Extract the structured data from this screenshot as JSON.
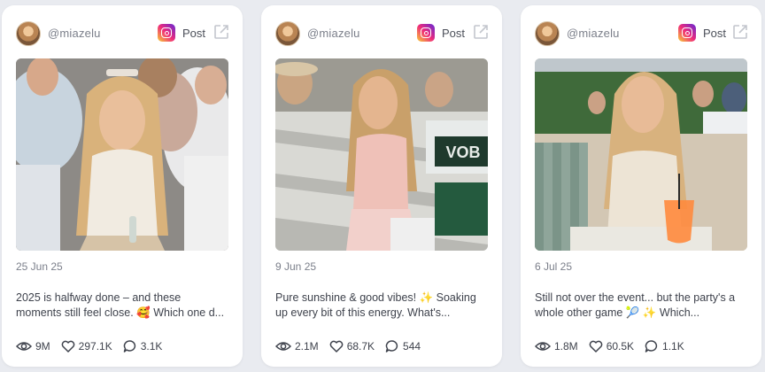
{
  "cards": [
    {
      "handle": "@miazelu",
      "platform_icon": "instagram-icon",
      "post_label": "Post",
      "date": "25 Jun 25",
      "caption": "2025 is halfway done – and these moments still feel close. 🥰 Which one d...",
      "views": "9M",
      "likes": "297.1K",
      "comments": "3.1K"
    },
    {
      "handle": "@miazelu",
      "platform_icon": "instagram-icon",
      "post_label": "Post",
      "date": "9 Jun 25",
      "caption": "Pure sunshine & good vibes! ✨ Soaking up every bit of this energy. What's...",
      "views": "2.1M",
      "likes": "68.7K",
      "comments": "544"
    },
    {
      "handle": "@miazelu",
      "platform_icon": "instagram-icon",
      "post_label": "Post",
      "date": "6 Jul 25",
      "caption": "Still not over the event... but the party's a whole other game 🎾 ✨ Which...",
      "views": "1.8M",
      "likes": "60.5K",
      "comments": "1.1K"
    }
  ],
  "sign_text": "VOB",
  "colors": {
    "card_bg": "#ffffff",
    "page_bg": "#e9ebf0",
    "text_primary": "#3e424c",
    "text_muted": "#7b7f8a"
  }
}
